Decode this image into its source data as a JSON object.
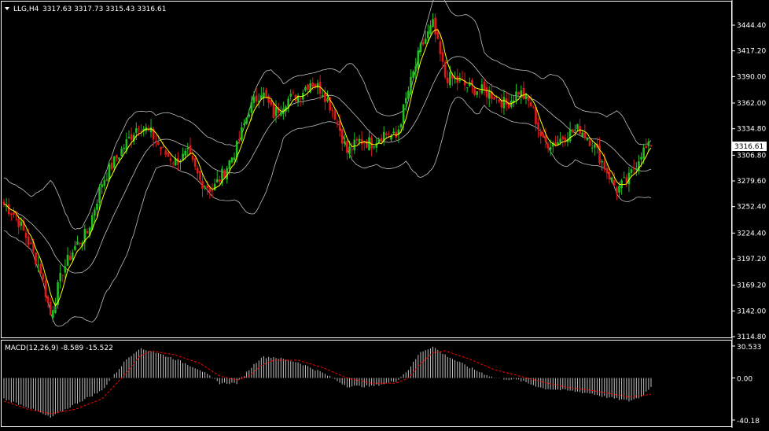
{
  "colors": {
    "background": "#000000",
    "bull": "#20c020",
    "bear": "#e01818",
    "ma": "#ffff00",
    "bands": "#c0c0c0",
    "macd_hist": "#c0c0c0",
    "macd_signal": "#ff0000",
    "frame": "#ffffff"
  },
  "header": {
    "symbol": "LLG,H4",
    "ohlc": "3317.63 3317.73 3315.43 3316.61",
    "menu_icon": "triangle-down-icon"
  },
  "price_axis": {
    "ticks": [
      "3444.40",
      "3417.20",
      "3390.00",
      "3362.00",
      "3334.80",
      "3306.80",
      "3279.60",
      "3252.40",
      "3224.40",
      "3197.20",
      "3169.20",
      "3142.00",
      "3114.80"
    ],
    "current_price": "3316.61"
  },
  "macd": {
    "label": "MACD(12,26,9) -8.589 -15.522",
    "ticks": [
      "30.533",
      "0.00",
      "-40.18"
    ]
  },
  "chart_data": [
    {
      "type": "candlestick",
      "title": "LLG,H4",
      "ylim": [
        3114.8,
        3444.4
      ],
      "overlays": [
        "moving average (yellow)",
        "Bollinger Bands (gray)"
      ],
      "last": {
        "open": 3317.63,
        "high": 3317.73,
        "low": 3315.43,
        "close": 3316.61
      },
      "close_path": [
        [
          0,
          3255
        ],
        [
          5,
          3242
        ],
        [
          10,
          3215
        ],
        [
          15,
          3185
        ],
        [
          19,
          3138
        ],
        [
          24,
          3185
        ],
        [
          29,
          3210
        ],
        [
          34,
          3225
        ],
        [
          40,
          3278
        ],
        [
          45,
          3300
        ],
        [
          50,
          3320
        ],
        [
          55,
          3340
        ],
        [
          60,
          3330
        ],
        [
          65,
          3310
        ],
        [
          70,
          3300
        ],
        [
          75,
          3308
        ],
        [
          80,
          3280
        ],
        [
          85,
          3270
        ],
        [
          90,
          3290
        ],
        [
          95,
          3315
        ],
        [
          100,
          3355
        ],
        [
          105,
          3375
        ],
        [
          110,
          3350
        ],
        [
          115,
          3365
        ],
        [
          120,
          3370
        ],
        [
          125,
          3385
        ],
        [
          130,
          3375
        ],
        [
          135,
          3350
        ],
        [
          140,
          3310
        ],
        [
          145,
          3322
        ],
        [
          150,
          3320
        ],
        [
          155,
          3330
        ],
        [
          160,
          3325
        ],
        [
          165,
          3375
        ],
        [
          170,
          3420
        ],
        [
          175,
          3445
        ],
        [
          180,
          3390
        ],
        [
          185,
          3385
        ],
        [
          190,
          3378
        ],
        [
          195,
          3375
        ],
        [
          200,
          3370
        ],
        [
          205,
          3360
        ],
        [
          210,
          3375
        ],
        [
          215,
          3360
        ],
        [
          220,
          3320
        ],
        [
          225,
          3320
        ],
        [
          230,
          3330
        ],
        [
          235,
          3335
        ],
        [
          240,
          3320
        ],
        [
          245,
          3295
        ],
        [
          250,
          3270
        ],
        [
          255,
          3282
        ],
        [
          260,
          3310
        ],
        [
          264,
          3316.61
        ]
      ]
    },
    {
      "type": "bar",
      "title": "MACD(12,26,9)",
      "ylim": [
        -40.18,
        30.533
      ],
      "latest": {
        "macd": -8.589,
        "signal": -15.522
      },
      "macd_path": [
        [
          0,
          -20
        ],
        [
          10,
          -28
        ],
        [
          19,
          -38
        ],
        [
          29,
          -25
        ],
        [
          40,
          -12
        ],
        [
          50,
          18
        ],
        [
          55,
          28
        ],
        [
          60,
          26
        ],
        [
          70,
          18
        ],
        [
          80,
          8
        ],
        [
          88,
          -5
        ],
        [
          95,
          -5
        ],
        [
          100,
          8
        ],
        [
          105,
          20
        ],
        [
          110,
          20
        ],
        [
          120,
          15
        ],
        [
          130,
          5
        ],
        [
          140,
          -8
        ],
        [
          150,
          -8
        ],
        [
          160,
          -3
        ],
        [
          165,
          8
        ],
        [
          170,
          25
        ],
        [
          175,
          30
        ],
        [
          180,
          22
        ],
        [
          190,
          10
        ],
        [
          200,
          0
        ],
        [
          210,
          -2
        ],
        [
          220,
          -10
        ],
        [
          230,
          -12
        ],
        [
          240,
          -15
        ],
        [
          245,
          -18
        ],
        [
          250,
          -20
        ],
        [
          255,
          -22
        ],
        [
          260,
          -18
        ],
        [
          264,
          -8.589
        ]
      ],
      "signal_path": [
        [
          0,
          -22
        ],
        [
          10,
          -30
        ],
        [
          19,
          -34
        ],
        [
          29,
          -30
        ],
        [
          40,
          -20
        ],
        [
          50,
          5
        ],
        [
          55,
          20
        ],
        [
          60,
          26
        ],
        [
          70,
          22
        ],
        [
          80,
          14
        ],
        [
          88,
          2
        ],
        [
          95,
          -2
        ],
        [
          100,
          2
        ],
        [
          105,
          12
        ],
        [
          110,
          17
        ],
        [
          120,
          17
        ],
        [
          130,
          10
        ],
        [
          140,
          0
        ],
        [
          150,
          -5
        ],
        [
          160,
          -5
        ],
        [
          165,
          0
        ],
        [
          170,
          14
        ],
        [
          175,
          24
        ],
        [
          180,
          26
        ],
        [
          190,
          18
        ],
        [
          200,
          8
        ],
        [
          210,
          2
        ],
        [
          220,
          -4
        ],
        [
          230,
          -9
        ],
        [
          240,
          -12
        ],
        [
          245,
          -14
        ],
        [
          250,
          -16
        ],
        [
          255,
          -18
        ],
        [
          260,
          -17
        ],
        [
          264,
          -15.522
        ]
      ]
    }
  ]
}
